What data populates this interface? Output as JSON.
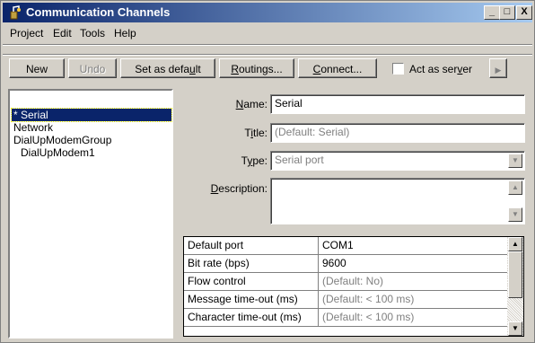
{
  "window": {
    "title": "Communication Channels",
    "controls": {
      "minimize": "_",
      "maximize": "□",
      "close": "X"
    }
  },
  "menu": [
    "Project",
    "Edit",
    "Tools",
    "Help"
  ],
  "toolbar": {
    "new": "New",
    "undo": "Undo",
    "set_default_pre": "Set as defa",
    "set_default_u": "u",
    "set_default_post": "lt",
    "routings_u": "R",
    "routings_rest": "outings...",
    "connect_u": "C",
    "connect_rest": "onnect...",
    "act_as_server_pre": "Act as ser",
    "act_as_server_u": "v",
    "act_as_server_post": "er",
    "act_as_server_checked": false
  },
  "tree": {
    "items": [
      {
        "label": "* Serial",
        "selected": true,
        "indent": 0
      },
      {
        "label": "Network",
        "selected": false,
        "indent": 0
      },
      {
        "label": "DialUpModemGroup",
        "selected": false,
        "indent": 0
      },
      {
        "label": "DialUpModem1",
        "selected": false,
        "indent": 1
      }
    ]
  },
  "form": {
    "name_label_u": "N",
    "name_label_rest": "ame:",
    "name_value": "Serial",
    "title_label_pre": "T",
    "title_label_u": "i",
    "title_label_post": "tle:",
    "title_placeholder": "(Default: Serial)",
    "type_label_pre": "T",
    "type_label_u": "y",
    "type_label_post": "pe:",
    "type_value": "Serial port",
    "description_label_u": "D",
    "description_label_rest": "escription:",
    "description_value": ""
  },
  "properties": [
    {
      "key": "Default port",
      "value": "COM1",
      "is_default": false
    },
    {
      "key": "Bit rate (bps)",
      "value": "9600",
      "is_default": false
    },
    {
      "key": "Flow control",
      "value": "(Default: No)",
      "is_default": true
    },
    {
      "key": "Message time-out (ms)",
      "value": "(Default: < 100 ms)",
      "is_default": true
    },
    {
      "key": "Character time-out (ms)",
      "value": "(Default: < 100 ms)",
      "is_default": true
    }
  ],
  "colors": {
    "selection": "#0a246a",
    "face": "#d4d0c8"
  }
}
